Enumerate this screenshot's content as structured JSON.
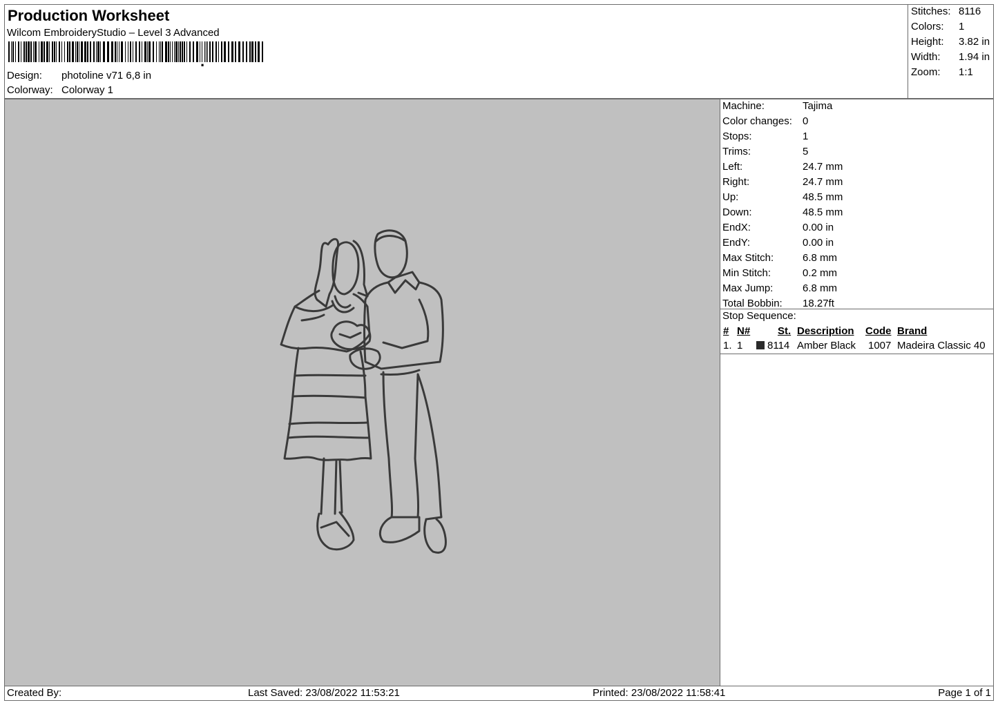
{
  "header": {
    "title": "Production Worksheet",
    "subtitle": "Wilcom EmbroideryStudio – Level 3 Advanced",
    "design_label": "Design:",
    "design_value": "photoline v71 6,8 in",
    "colorway_label": "Colorway:",
    "colorway_value": "Colorway 1"
  },
  "stats": [
    {
      "label": "Stitches:",
      "value": "8116"
    },
    {
      "label": "Colors:",
      "value": "1"
    },
    {
      "label": "Height:",
      "value": "3.82 in"
    },
    {
      "label": "Width:",
      "value": "1.94 in"
    },
    {
      "label": "Zoom:",
      "value": "1:1"
    }
  ],
  "details": [
    {
      "label": "Machine:",
      "value": "Tajima"
    },
    {
      "label": "Color changes:",
      "value": "0"
    },
    {
      "label": "Stops:",
      "value": "1"
    },
    {
      "label": "Trims:",
      "value": "5"
    },
    {
      "label": "Left:",
      "value": "24.7 mm"
    },
    {
      "label": "Right:",
      "value": "24.7 mm"
    },
    {
      "label": "Up:",
      "value": "48.5 mm"
    },
    {
      "label": "Down:",
      "value": "48.5 mm"
    },
    {
      "label": "EndX:",
      "value": "0.00 in"
    },
    {
      "label": "EndY:",
      "value": "0.00 in"
    },
    {
      "label": "Max Stitch:",
      "value": "6.8 mm"
    },
    {
      "label": "Min Stitch:",
      "value": "0.2 mm"
    },
    {
      "label": "Max Jump:",
      "value": "6.8 mm"
    },
    {
      "label": "Total Bobbin:",
      "value": "18.27ft"
    }
  ],
  "stop_sequence": {
    "title": "Stop Sequence:",
    "headers": {
      "num": "#",
      "n": "N#",
      "st": "St.",
      "description": "Description",
      "code": "Code",
      "brand": "Brand"
    },
    "rows": [
      {
        "num": "1.",
        "n": "1",
        "swatch_color": "#2b2b2b",
        "st": "8114",
        "description": "Amber Black",
        "code": "1007",
        "brand": "Madeira Classic 40"
      }
    ]
  },
  "footer": {
    "created_by": "Created By:",
    "last_saved": "Last Saved: 23/08/2022 11:53:21",
    "printed": "Printed: 23/08/2022 11:58:41",
    "page": "Page 1 of 1"
  },
  "colors": {
    "canvas_bg": "#c0c0c0",
    "thread": "#3a3a3a"
  }
}
